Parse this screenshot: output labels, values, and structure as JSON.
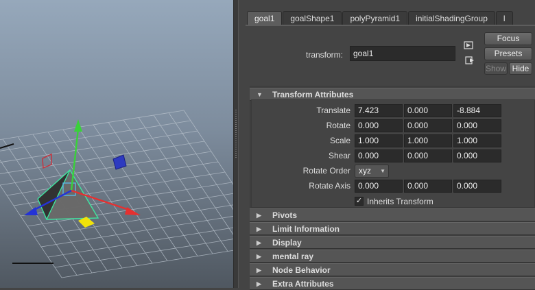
{
  "tabs": [
    {
      "label": "goal1",
      "active": true
    },
    {
      "label": "goalShape1",
      "active": false
    },
    {
      "label": "polyPyramid1",
      "active": false
    },
    {
      "label": "initialShadingGroup",
      "active": false
    },
    {
      "label": "l",
      "active": false
    }
  ],
  "header": {
    "transform_label": "transform:",
    "transform_value": "goal1",
    "focus_label": "Focus",
    "presets_label": "Presets",
    "show_label": "Show",
    "hide_label": "Hide"
  },
  "transform_section": {
    "title": "Transform Attributes",
    "rows": [
      {
        "label": "Translate",
        "values": [
          "7.423",
          "0.000",
          "-8.884"
        ]
      },
      {
        "label": "Rotate",
        "values": [
          "0.000",
          "0.000",
          "0.000"
        ]
      },
      {
        "label": "Scale",
        "values": [
          "1.000",
          "1.000",
          "1.000"
        ]
      },
      {
        "label": "Shear",
        "values": [
          "0.000",
          "0.000",
          "0.000"
        ]
      }
    ],
    "rotate_order_label": "Rotate Order",
    "rotate_order_value": "xyz",
    "rotate_axis_label": "Rotate Axis",
    "rotate_axis_values": [
      "0.000",
      "0.000",
      "0.000"
    ],
    "inherits_label": "Inherits Transform",
    "inherits_checked": true
  },
  "collapsed_sections": [
    "Pivots",
    "Limit Information",
    "Display",
    "mental ray",
    "Node Behavior",
    "Extra Attributes"
  ],
  "icons": {
    "expanded_arrow": "▼",
    "collapsed_arrow": "▶",
    "check": "✓",
    "caret": "▼"
  },
  "colors": {
    "x_axis": "#e53030",
    "y_axis": "#39d13a",
    "z_axis": "#2433d6",
    "selection": "#3fe6a0",
    "panel_bg": "#444444",
    "field_bg": "#2b2b2b"
  }
}
